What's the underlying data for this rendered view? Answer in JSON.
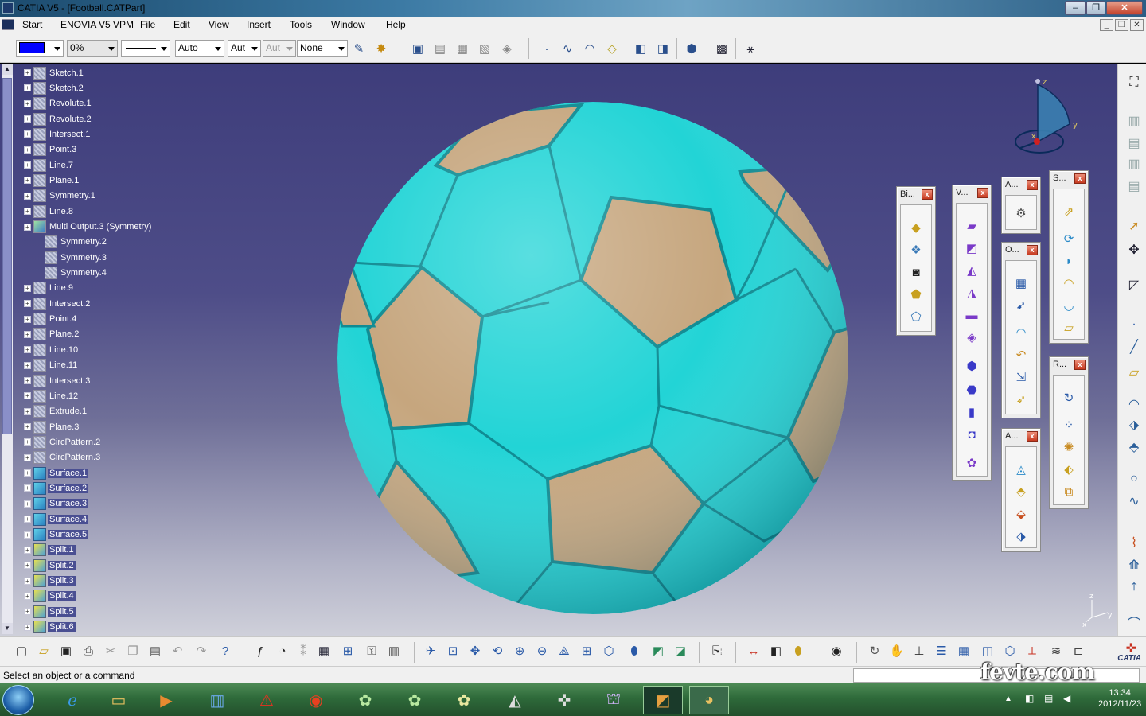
{
  "window": {
    "title": "CATIA V5 - [Football.CATPart]"
  },
  "menu": {
    "items": [
      "Start",
      "ENOVIA V5 VPM",
      "File",
      "Edit",
      "View",
      "Insert",
      "Tools",
      "Window",
      "Help"
    ]
  },
  "toolbar": {
    "color": "#0000ff",
    "transparency": "0%",
    "linetype_value": "Auto",
    "thickness_value": "Aut",
    "point_value": "Aut",
    "layer_value": "None"
  },
  "tree": {
    "items": [
      {
        "label": "Sketch.1",
        "type": "feature"
      },
      {
        "label": "Sketch.2",
        "type": "feature"
      },
      {
        "label": "Revolute.1",
        "type": "feature"
      },
      {
        "label": "Revolute.2",
        "type": "feature"
      },
      {
        "label": "Intersect.1",
        "type": "feature"
      },
      {
        "label": "Point.3",
        "type": "feature"
      },
      {
        "label": "Line.7",
        "type": "feature"
      },
      {
        "label": "Plane.1",
        "type": "feature"
      },
      {
        "label": "Symmetry.1",
        "type": "feature"
      },
      {
        "label": "Line.8",
        "type": "feature"
      },
      {
        "label": "Multi Output.3 (Symmetry)",
        "type": "multi"
      },
      {
        "label": "Symmetry.2",
        "type": "child"
      },
      {
        "label": "Symmetry.3",
        "type": "child"
      },
      {
        "label": "Symmetry.4",
        "type": "child"
      },
      {
        "label": "Line.9",
        "type": "feature"
      },
      {
        "label": "Intersect.2",
        "type": "feature"
      },
      {
        "label": "Point.4",
        "type": "feature"
      },
      {
        "label": "Plane.2",
        "type": "feature"
      },
      {
        "label": "Line.10",
        "type": "feature"
      },
      {
        "label": "Line.11",
        "type": "feature"
      },
      {
        "label": "Intersect.3",
        "type": "feature"
      },
      {
        "label": "Line.12",
        "type": "feature"
      },
      {
        "label": "Extrude.1",
        "type": "feature"
      },
      {
        "label": "Plane.3",
        "type": "feature"
      },
      {
        "label": "CircPattern.2",
        "type": "feature"
      },
      {
        "label": "CircPattern.3",
        "type": "feature"
      },
      {
        "label": "Surface.1",
        "type": "surface"
      },
      {
        "label": "Surface.2",
        "type": "surface"
      },
      {
        "label": "Surface.3",
        "type": "surface"
      },
      {
        "label": "Surface.4",
        "type": "surface"
      },
      {
        "label": "Surface.5",
        "type": "surface"
      },
      {
        "label": "Split.1",
        "type": "split"
      },
      {
        "label": "Split.2",
        "type": "split"
      },
      {
        "label": "Split.3",
        "type": "split"
      },
      {
        "label": "Split.4",
        "type": "split"
      },
      {
        "label": "Split.5",
        "type": "split"
      },
      {
        "label": "Split.6",
        "type": "split"
      }
    ]
  },
  "panels": [
    {
      "title": "Bi..."
    },
    {
      "title": "V..."
    },
    {
      "title": "A..."
    },
    {
      "title": "O..."
    },
    {
      "title": "A..."
    },
    {
      "title": "S..."
    },
    {
      "title": "R..."
    }
  ],
  "compass": {
    "z": "z",
    "y": "y",
    "x": "x"
  },
  "triad": {
    "z": "z",
    "y": "y",
    "x": "x"
  },
  "catia_logo": "CATIA",
  "status": {
    "text": "Select an object or a command"
  },
  "watermark": "fevte.com",
  "clock": {
    "time": "13:34",
    "date": "2012/11/23"
  },
  "colors": {
    "ball_cyan": "#22d4d6",
    "ball_tan": "#c6a67e",
    "viewport_top": "#3e3d7b"
  }
}
